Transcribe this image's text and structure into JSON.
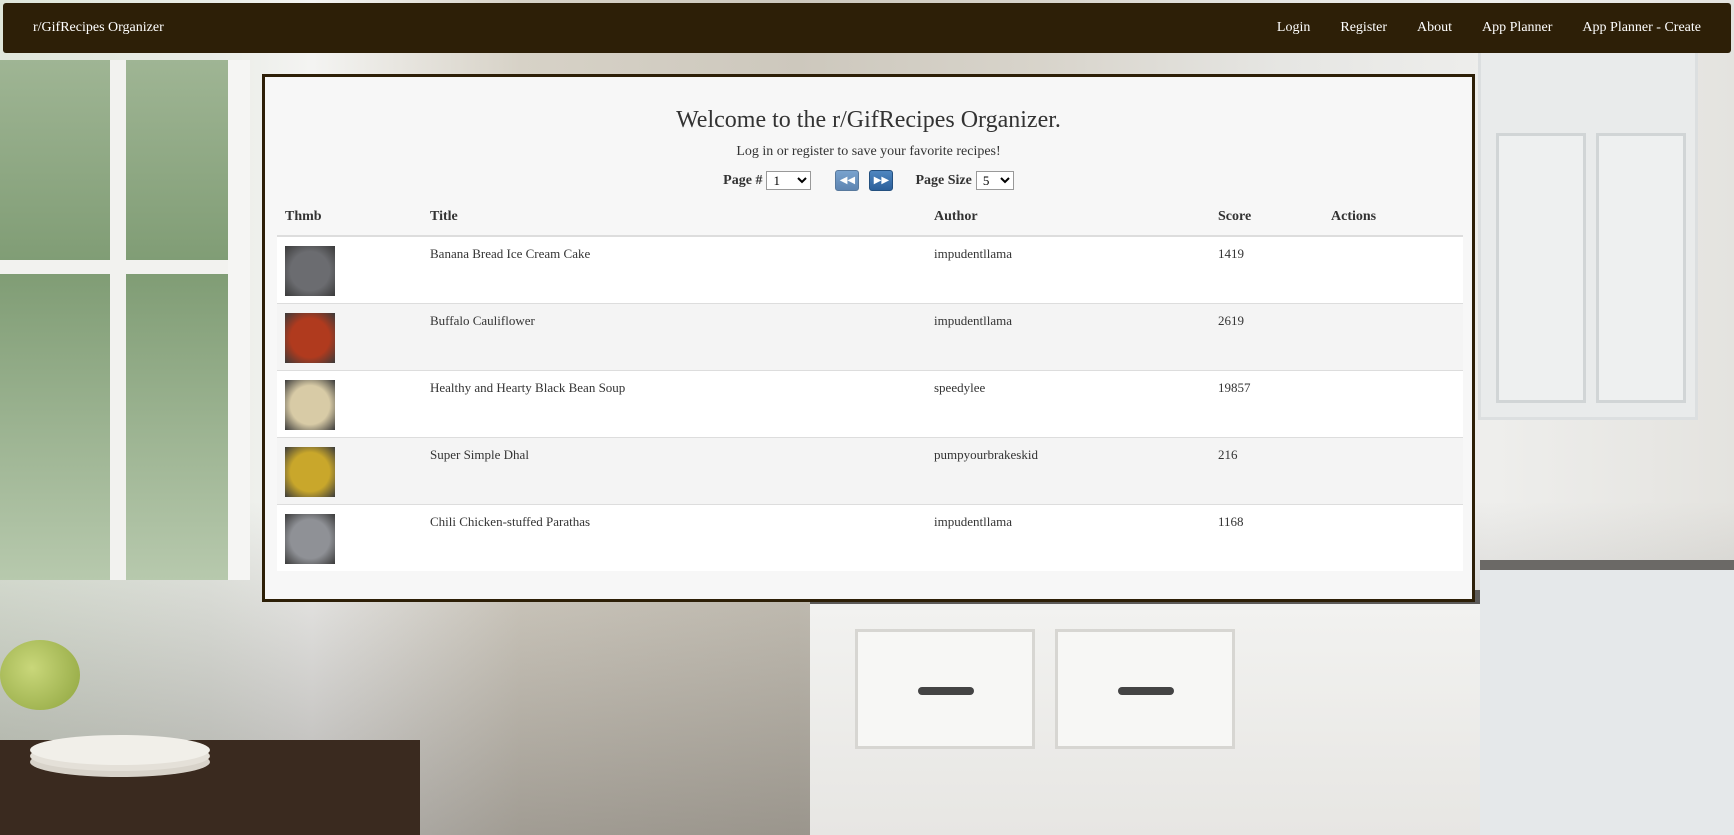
{
  "navbar": {
    "brand": "r/GifRecipes Organizer",
    "links": [
      "Login",
      "Register",
      "About",
      "App Planner",
      "App Planner - Create"
    ]
  },
  "main": {
    "welcome": "Welcome to the r/GifRecipes Organizer.",
    "subtitle": "Log in or register to save your favorite recipes!",
    "pager": {
      "page_label": "Page #",
      "page_value": "1",
      "page_size_label": "Page Size",
      "page_size_value": "5",
      "prev_icon": "fast-backward-icon",
      "next_icon": "fast-forward-icon"
    },
    "table": {
      "headers": [
        "Thmb",
        "Title",
        "Author",
        "Score",
        "Actions"
      ],
      "rows": [
        {
          "title": "Banana Bread Ice Cream Cake",
          "author": "impudentllama",
          "score": "1419",
          "thumb_color": "#6b6c70"
        },
        {
          "title": "Buffalo Cauliflower",
          "author": "impudentllama",
          "score": "2619",
          "thumb_color": "#b03a1e"
        },
        {
          "title": "Healthy and Hearty Black Bean Soup",
          "author": "speedylee",
          "score": "19857",
          "thumb_color": "#d8cba6"
        },
        {
          "title": "Super Simple Dhal",
          "author": "pumpyourbrakeskid",
          "score": "216",
          "thumb_color": "#c9a72b"
        },
        {
          "title": "Chili Chicken-stuffed Parathas",
          "author": "impudentllama",
          "score": "1168",
          "thumb_color": "#8f9196"
        }
      ]
    }
  },
  "colors": {
    "navbar_bg": "#2d1f07",
    "panel_bg": "#f7f7f7",
    "button_blue": "#2b5f9a"
  }
}
